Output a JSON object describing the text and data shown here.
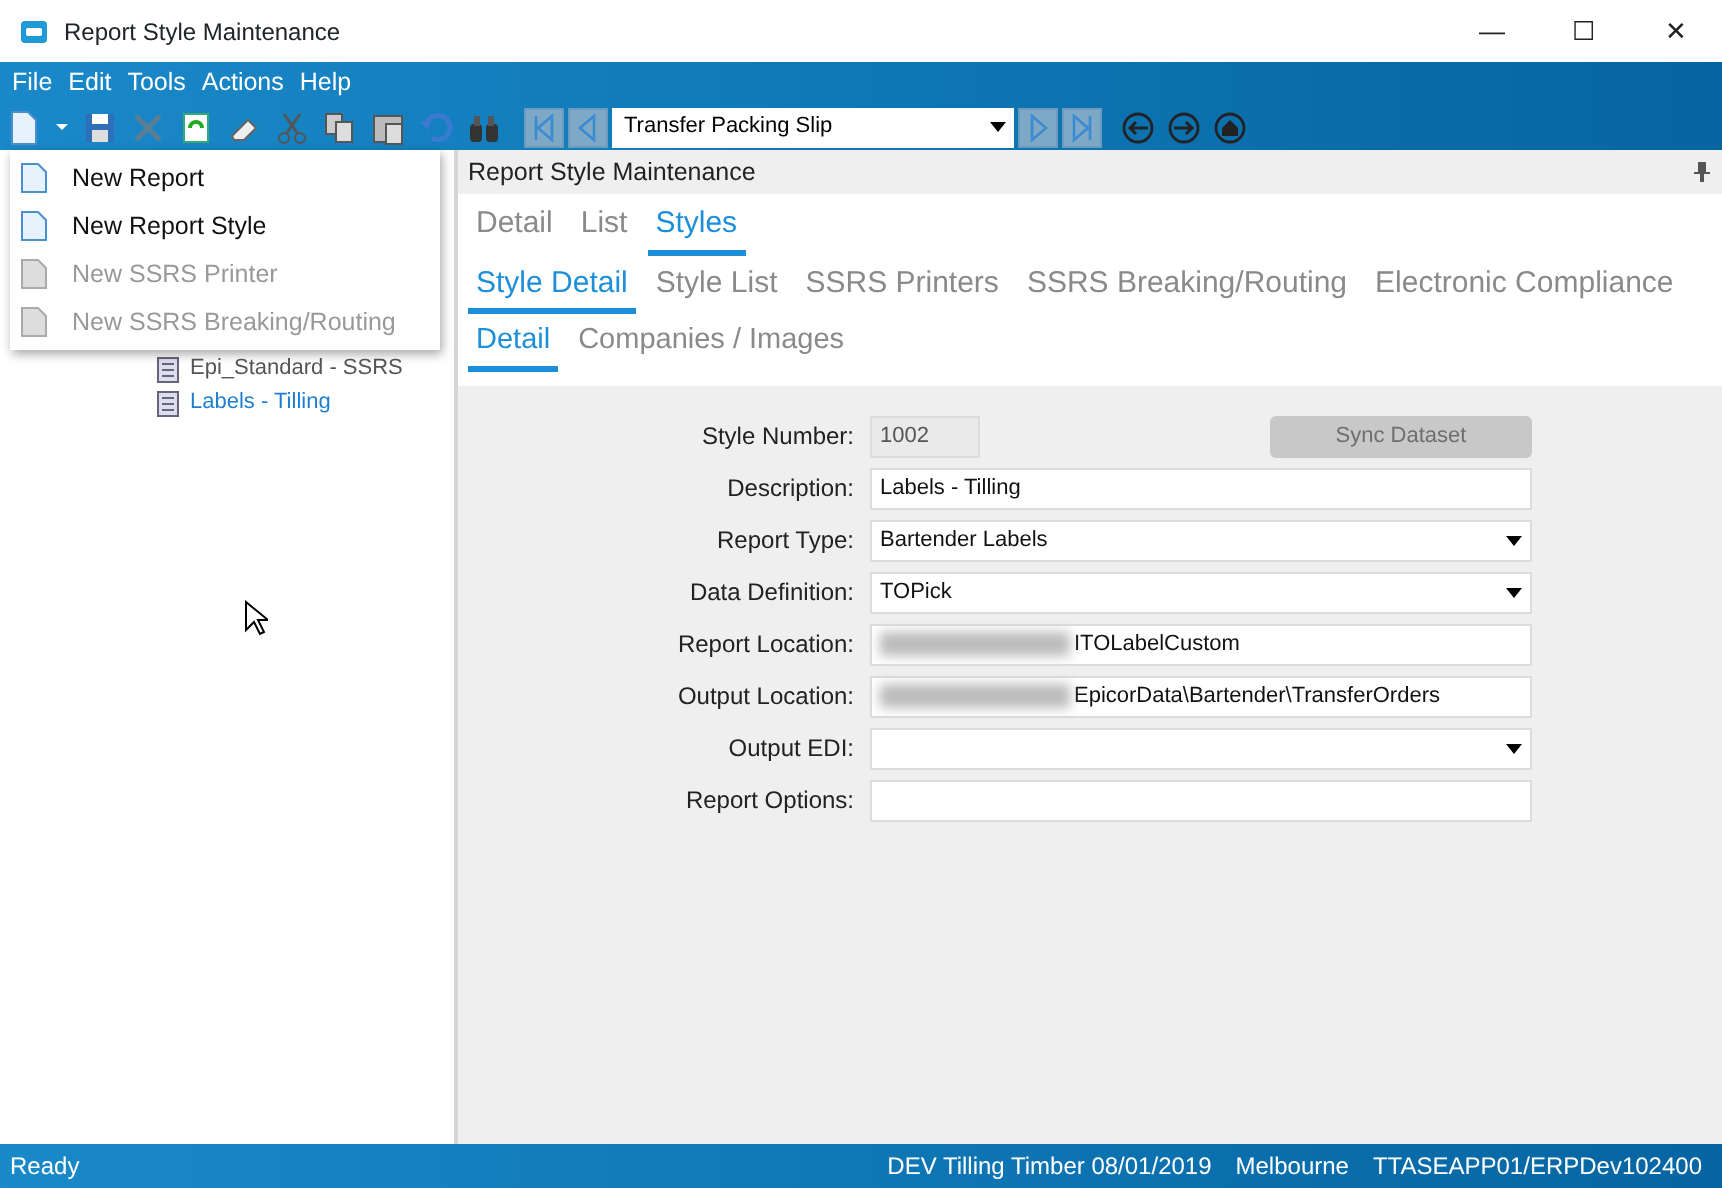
{
  "window": {
    "title": "Report Style Maintenance",
    "buttons": [
      "—",
      "☐",
      "✕"
    ]
  },
  "menu_bar": [
    "File",
    "Edit",
    "Tools",
    "Actions",
    "Help"
  ],
  "toolbar": {
    "record_selector": "Transfer Packing Slip"
  },
  "new_menu": [
    {
      "label": "New Report",
      "disabled": false
    },
    {
      "label": "New Report Style",
      "disabled": false
    },
    {
      "label": "New SSRS Printer",
      "disabled": true
    },
    {
      "label": "New SSRS Breaking/Routing",
      "disabled": true
    }
  ],
  "tree": {
    "items": [
      {
        "label": "Epi_Standard - SSRS",
        "selected": false
      },
      {
        "label": "Labels - Tilling",
        "selected": true
      }
    ]
  },
  "panel": {
    "title": "Report Style Maintenance"
  },
  "tabs": [
    {
      "label": "Detail",
      "selected": false
    },
    {
      "label": "List",
      "selected": false
    },
    {
      "label": "Styles",
      "selected": true
    }
  ],
  "subtabs": [
    {
      "label": "Style Detail",
      "selected": true
    },
    {
      "label": "Style List",
      "selected": false
    },
    {
      "label": "SSRS Printers",
      "selected": false
    },
    {
      "label": "SSRS Breaking/Routing",
      "selected": false
    },
    {
      "label": "Electronic Compliance",
      "selected": false
    }
  ],
  "detail_tabs": [
    {
      "label": "Detail",
      "selected": true
    },
    {
      "label": "Companies / Images",
      "selected": false
    }
  ],
  "form": {
    "sync_button": {
      "label": "Sync Dataset",
      "disabled": true
    },
    "fields": [
      {
        "label": "Style Number:",
        "value": "1002",
        "kind": "readonly"
      },
      {
        "label": "Description:",
        "value": "Labels - Tilling",
        "kind": "text"
      },
      {
        "label": "Report Type:",
        "value": "Bartender Labels",
        "kind": "combo"
      },
      {
        "label": "Data Definition:",
        "value": "TOPick",
        "kind": "combo"
      },
      {
        "label": "Report Location:",
        "value": "ITOLabelCustom",
        "kind": "redacted"
      },
      {
        "label": "Output Location:",
        "value": "EpicorData\\Bartender\\TransferOrders",
        "kind": "redacted"
      },
      {
        "label": "Output EDI:",
        "kind": "combo"
      },
      {
        "label": "Report Options:",
        "kind": "text"
      }
    ]
  },
  "status_bar": {
    "status": "Ready",
    "items": [
      "DEV Tilling Timber 08/01/2019",
      "Melbourne",
      "TTASEAPP01/ERPDev102400"
    ]
  }
}
